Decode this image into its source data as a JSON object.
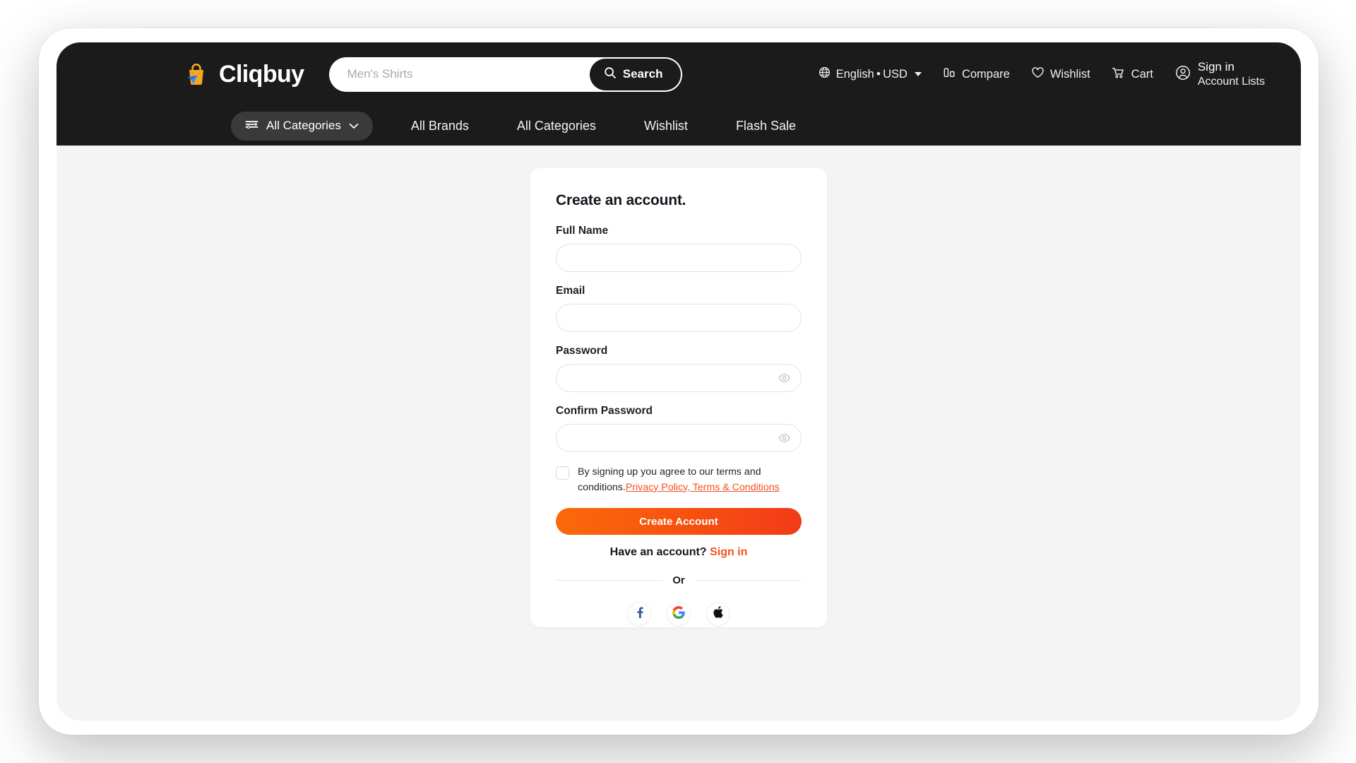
{
  "brand": {
    "name": "Cliqbuy",
    "logo_bag_color": "#F5A623",
    "logo_arrow_color": "#1F6FEB"
  },
  "header": {
    "search": {
      "placeholder": "Men's Shirts",
      "value": "",
      "button_label": "Search",
      "icon": "search-icon"
    },
    "locale": {
      "label": "English • USD",
      "icon": "globe-icon",
      "has_dropdown": true
    },
    "compare": {
      "label": "Compare",
      "icon": "compare-bars-icon"
    },
    "wishlist": {
      "label": "Wishlist",
      "icon": "heart-icon"
    },
    "cart": {
      "label": "Cart",
      "icon": "cart-icon"
    },
    "account": {
      "line1": "Sign in",
      "line2": "Account Lists",
      "icon": "user-circle-icon",
      "has_dropdown": true
    }
  },
  "nav": {
    "all_categories_pill": {
      "label": "All Categories",
      "icon": "filter-lines-icon",
      "chevron": "chevron-down-icon"
    },
    "links": [
      {
        "label": "All Brands"
      },
      {
        "label": "All Categories"
      },
      {
        "label": "Wishlist"
      },
      {
        "label": "Flash Sale"
      }
    ]
  },
  "signup": {
    "title": "Create an account.",
    "fields": [
      {
        "label": "Full Name",
        "value": "",
        "placeholder": "",
        "type": "text"
      },
      {
        "label": "Email",
        "value": "",
        "placeholder": "",
        "type": "email"
      },
      {
        "label": "Password",
        "value": "",
        "placeholder": "",
        "type": "password",
        "toggle_icon": "eye-icon"
      },
      {
        "label": "Confirm Password",
        "value": "",
        "placeholder": "",
        "type": "password",
        "toggle_icon": "eye-icon"
      }
    ],
    "terms": {
      "checked": false,
      "text": "By signing up you agree to our terms and conditions.",
      "link_text": "Privacy Policy, Terms & Conditions",
      "link_color": "#F4511E"
    },
    "submit_label": "Create Account",
    "have_account_text": "Have an account?",
    "sign_in_label": "Sign in",
    "divider_label": "Or",
    "social_logins": [
      {
        "name": "facebook-icon",
        "label": "Facebook",
        "color": "#3B5998"
      },
      {
        "name": "google-icon",
        "label": "Google",
        "color": "#4285F4"
      },
      {
        "name": "apple-icon",
        "label": "Apple",
        "color": "#111111"
      }
    ]
  },
  "theme": {
    "header_bg": "#1B1B1B",
    "page_bg": "#F4F4F4",
    "accent": "#F4511E",
    "accent_gradient_start": "#FB6A0B",
    "accent_gradient_end": "#F23B18"
  }
}
